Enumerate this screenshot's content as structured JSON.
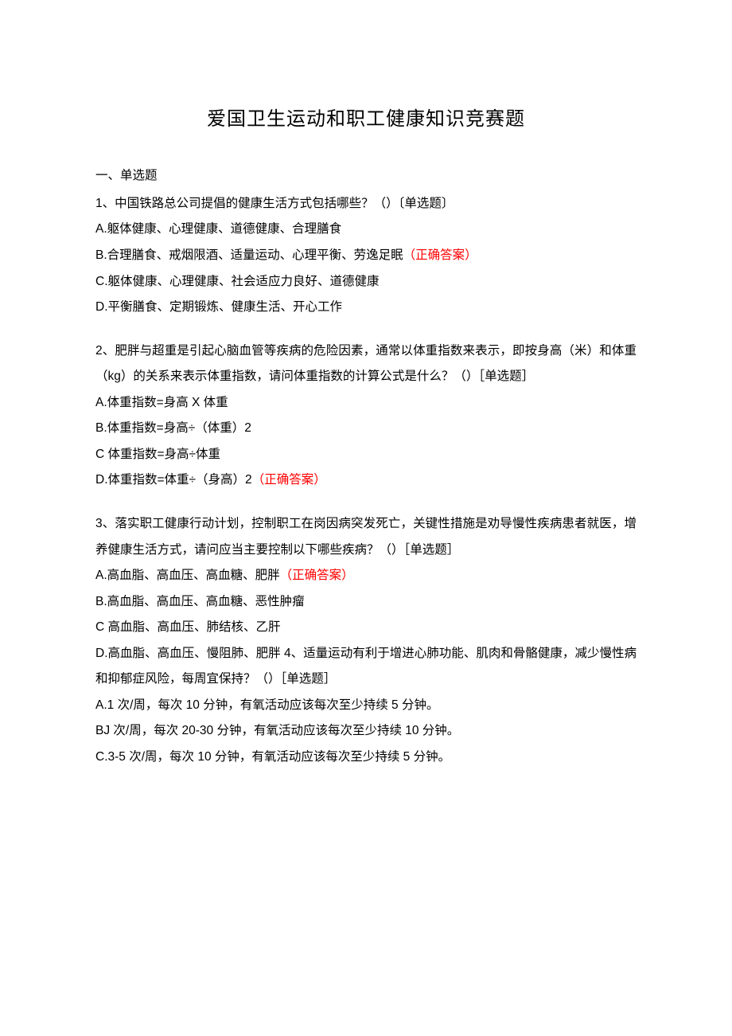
{
  "title": "爱国卫生运动和职工健康知识竞赛题",
  "sectionLabel": "一、单选题",
  "q1": {
    "stem": "1、中国铁路总公司提倡的健康生活方式包括哪些？（）〔单选题〕",
    "optA": "A.躯体健康、心理健康、道德健康、合理膳食",
    "optB_prefix": "B.合理膳食、戒烟限酒、适量运动、心理平衡、劳逸足眠",
    "optB_correct": "（正确答案）",
    "optC": "C.躯体健康、心理健康、社会适应力良好、道德健康",
    "optD": "D.平衡膳食、定期锻炼、健康生活、开心工作"
  },
  "q2": {
    "stem": "2、肥胖与超重是引起心脑血管等疾病的危险因素，通常以体重指数来表示，即按身高（米）和体重（kg）的关系来表示体重指数，请问体重指数的计算公式是什么？（）［单选题］",
    "optA": "A.体重指数=身高 X 体重",
    "optB": "B.体重指数=身高÷（体重）2",
    "optC": "C 体重指数=身高÷体重",
    "optD_prefix": "D.体重指数=体重÷（身高）2",
    "optD_correct": "（正确答案）"
  },
  "q3": {
    "stem": "3、落实职工健康行动计划，控制职工在岗因病突发死亡，关键性措施是劝导慢性疾病患者就医，增养健康生活方式，请问应当主要控制以下哪些疾病？（）［单选题］",
    "optA_prefix": "A.高血脂、高血压、高血糖、肥胖",
    "optA_correct": "（正确答案）",
    "optB": "B.高血脂、高血压、高血糖、恶性肿瘤",
    "optC": "C 高血脂、高血压、肺结核、乙肝",
    "optD_and_q4": "D.高血脂、高血压、慢阻肺、肥胖 4、适量运动有利于增进心肺功能、肌肉和骨骼健康，减少慢性病和抑郁症风险，每周宜保持？（）［单选题］",
    "q4_optA": "A.1 次/周，每次 10 分钟，有氧活动应该每次至少持续 5 分钟。",
    "q4_optB": "BJ 次/周，每次 20-30 分钟，有氧活动应该每次至少持续 10 分钟。",
    "q4_optC": "C.3-5 次/周，每次 10 分钟，有氧活动应该每次至少持续 5 分钟。"
  }
}
